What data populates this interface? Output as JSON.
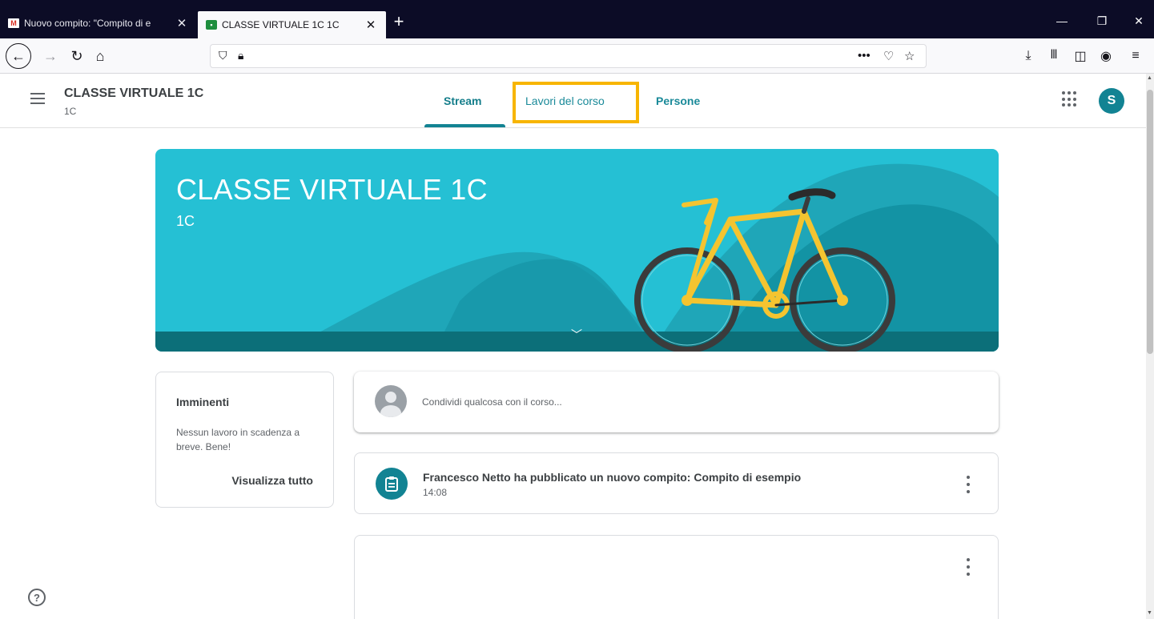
{
  "browser": {
    "tabs": [
      {
        "title": "Nuovo compito: \"Compito di e",
        "favicon": "gmail-icon",
        "active": false
      },
      {
        "title": "CLASSE VIRTUALE 1C 1C",
        "favicon": "classroom-icon",
        "active": true
      }
    ],
    "new_tab_label": "+",
    "close_glyph": "✕"
  },
  "classroom": {
    "class_name": "CLASSE VIRTUALE 1C",
    "section": "1C",
    "tabs": [
      "Stream",
      "Lavori del corso",
      "Persone"
    ],
    "active_tab": "Stream",
    "highlighted_tab": "Lavori del corso",
    "user_initial": "S",
    "accent_color": "#128393",
    "highlight_color": "#f7b500"
  },
  "banner": {
    "title": "CLASSE VIRTUALE 1C",
    "subtitle": "1C"
  },
  "upcoming": {
    "heading": "Imminenti",
    "message": "Nessun lavoro in scadenza a breve. Bene!",
    "link": "Visualizza tutto"
  },
  "stream": {
    "share_placeholder": "Condividi qualcosa con il corso...",
    "posts": [
      {
        "title": "Francesco Netto ha pubblicato un nuovo compito: Compito di esempio",
        "time": "14:08"
      }
    ]
  },
  "help": {
    "glyph": "?"
  }
}
